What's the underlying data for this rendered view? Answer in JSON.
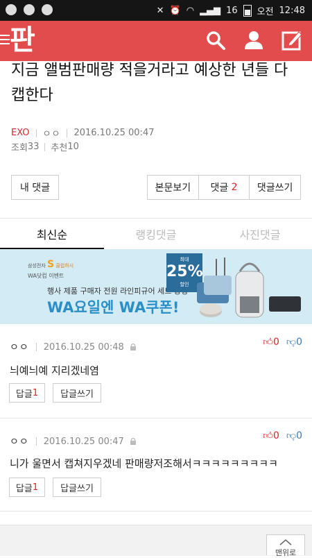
{
  "statusbar": {
    "signal_text": "16",
    "ampm": "오전",
    "time": "12:48"
  },
  "appbar": {
    "logo": "판"
  },
  "post": {
    "title": "지금 앨범판매량 적을거라고 예상한 년들 다 캡한다",
    "category": "EXO",
    "author": "ㅇㅇ",
    "datetime": "2016.10.25 00:47",
    "views_label": "조회",
    "views": "33",
    "recommend_label": "추천",
    "recommend": "10"
  },
  "actions": {
    "my_comments": "내 댓글",
    "view_body": "본문보기",
    "comments_label": "댓글",
    "comments_count": "2",
    "write_comment": "댓글쓰기"
  },
  "tabs": [
    {
      "label": "최신순",
      "active": true
    },
    {
      "label": "랭킹댓글",
      "active": false
    },
    {
      "label": "사진댓글",
      "active": false
    }
  ],
  "banner": {
    "brand": "삼성전자",
    "brand_mark": "S",
    "brand_sub": "클럽하시",
    "sub": "WA닷컴 이벤트",
    "line1": "행사 제품 구매자 전원 라인피규어 세트 증정",
    "line2": "WA요일엔 WA쿠폰!",
    "badge_small": "최대",
    "badge_value": "25%",
    "badge_sub": "할인"
  },
  "comments": [
    {
      "author": "ㅇㅇ",
      "datetime": "2016.10.25 00:48",
      "up": "0",
      "down": "0",
      "text": "늬예늬예 지리겠네염",
      "reply_label": "답글",
      "reply_count": "1",
      "write_reply": "답글쓰기"
    },
    {
      "author": "ㅇㅇ",
      "datetime": "2016.10.25 00:47",
      "up": "0",
      "down": "0",
      "text": "니가 울면서 캡쳐지우겠네 판매량저조해서ㅋㅋㅋㅋㅋㅋㅋㅋㅋ",
      "reply_label": "답글",
      "reply_count": "1",
      "write_reply": "답글쓰기"
    }
  ],
  "footer": {
    "top_label": "맨위로"
  },
  "colors": {
    "brand_red": "#e34c4c",
    "accent_red": "#d2262b",
    "down_blue": "#3a7bb4",
    "banner_blue": "#2b8fc6"
  }
}
